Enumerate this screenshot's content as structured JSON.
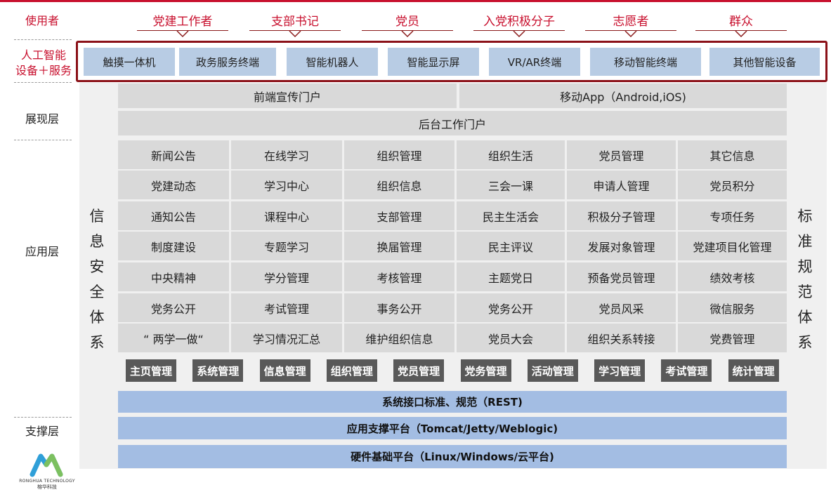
{
  "layers": {
    "users": "使用者",
    "ai_line1": "人工智能",
    "ai_line2": "设备＋服务",
    "presentation": "展现层",
    "application": "应用层",
    "support": "支撑层"
  },
  "roles": [
    "党建工作者",
    "支部书记",
    "党员",
    "入党积极分子",
    "志愿者",
    "群众"
  ],
  "ai_devices": [
    "触摸一体机",
    "政务服务终端",
    "智能机器人",
    "智能显示屏",
    "VR/AR终端",
    "移动智能终端",
    "其他智能设备"
  ],
  "left_column": [
    "信",
    "息",
    "安",
    "全",
    "体",
    "系"
  ],
  "right_column": [
    "标",
    "准",
    "规",
    "范",
    "体",
    "系"
  ],
  "portals": {
    "front": "前端宣传门户",
    "mobile": "移动App（Android,iOS)",
    "backend": "后台工作门户"
  },
  "functions": [
    [
      "新闻公告",
      "在线学习",
      "组织管理",
      "组织生活",
      "党员管理",
      "其它信息"
    ],
    [
      "党建动态",
      "学习中心",
      "组织信息",
      "三会一课",
      "申请人管理",
      "党员积分"
    ],
    [
      "通知公告",
      "课程中心",
      "支部管理",
      "民主生活会",
      "积极分子管理",
      "专项任务"
    ],
    [
      "制度建设",
      "专题学习",
      "换届管理",
      "民主评议",
      "发展对象管理",
      "党建项目化管理"
    ],
    [
      "中央精神",
      "学分管理",
      "考核管理",
      "主题党日",
      "预备党员管理",
      "绩效考核"
    ],
    [
      "党务公开",
      "考试管理",
      "事务公开",
      "党务公开",
      "党员风采",
      "微信服务"
    ],
    [
      "“ 两学一做“",
      "学习情况汇总",
      "维护组织信息",
      "党员大会",
      "组织关系转接",
      "党费管理"
    ]
  ],
  "modules": [
    "主页管理",
    "系统管理",
    "信息管理",
    "组织管理",
    "党员管理",
    "党务管理",
    "活动管理",
    "学习管理",
    "考试管理",
    "统计管理"
  ],
  "platform": {
    "interface": "系统接口标准、规范（REST)",
    "support": "应用支撑平台（Tomcat/Jetty/Weblogic)",
    "hardware": "硬件基础平台（Linux/Windows/云平台)"
  },
  "logo": {
    "company_en": "RONGHUA TECHNOLOGY",
    "company_cn": "榕华科技"
  },
  "colors": {
    "accent_red": "#c8102e",
    "frame_red": "#8b1118",
    "device_blue": "#b8cce4",
    "platform_blue": "#a3bde3",
    "cell_gray": "#d9d9d9",
    "module_dark": "#595959"
  }
}
